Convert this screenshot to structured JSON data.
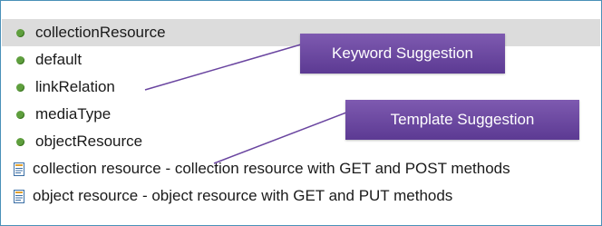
{
  "suggestions": {
    "items": [
      {
        "label": "collectionResource",
        "kind": "keyword",
        "selected": true
      },
      {
        "label": "default",
        "kind": "keyword"
      },
      {
        "label": "linkRelation",
        "kind": "keyword"
      },
      {
        "label": "mediaType",
        "kind": "keyword"
      },
      {
        "label": "objectResource",
        "kind": "keyword"
      },
      {
        "label": "collection resource - collection resource with GET and POST methods",
        "kind": "template"
      },
      {
        "label": "object resource - object resource with GET and PUT methods",
        "kind": "template"
      }
    ]
  },
  "callouts": {
    "keyword": "Keyword Suggestion",
    "template": "Template Suggestion"
  },
  "colors": {
    "bullet": "#5f9f3e",
    "callout": "#6a45a0",
    "border": "#4a90b8",
    "selected_row": "#dcdcdc",
    "template_icon": "#3a6ea5"
  },
  "icons": {
    "keyword": "green-dot-icon",
    "template": "template-document-icon"
  }
}
